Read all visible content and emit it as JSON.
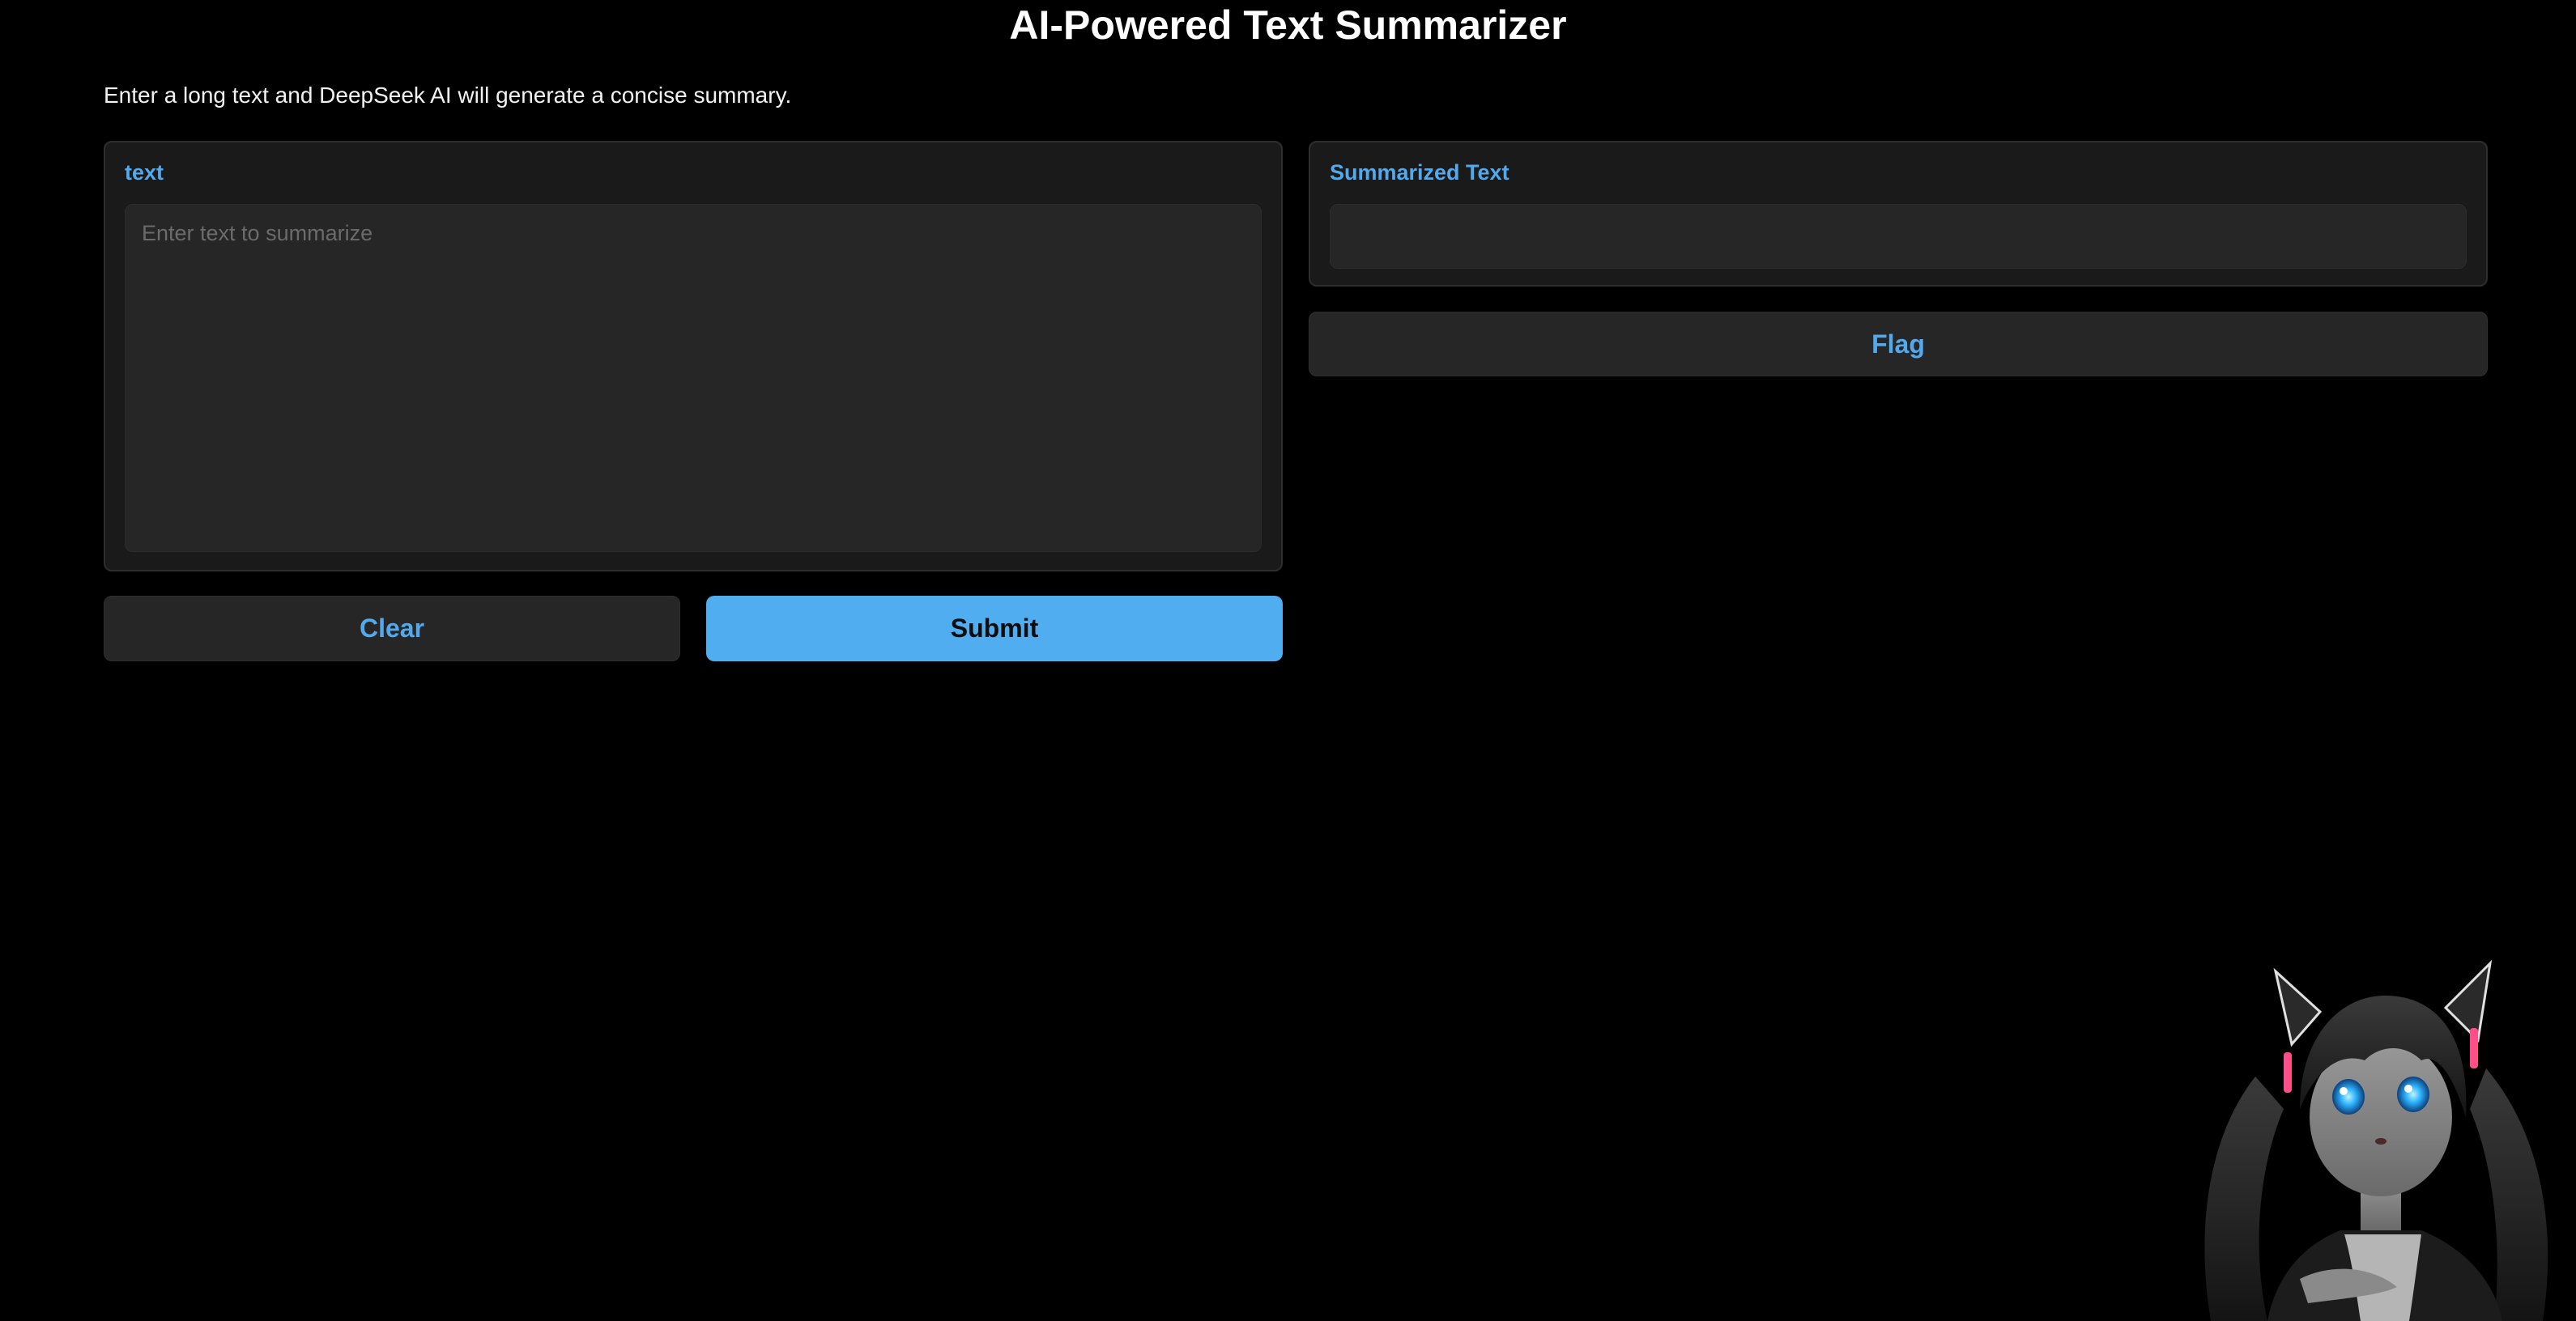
{
  "header": {
    "title": "AI-Powered Text Summarizer",
    "description": "Enter a long text and DeepSeek AI will generate a concise summary."
  },
  "input": {
    "label": "text",
    "placeholder": "Enter text to summarize",
    "value": ""
  },
  "output": {
    "label": "Summarized Text",
    "value": ""
  },
  "buttons": {
    "flag": "Flag",
    "clear": "Clear",
    "submit": "Submit"
  },
  "colors": {
    "accent": "#53a9ec",
    "primary_button": "#50adf0",
    "background": "#000000",
    "panel": "#1a1a1a",
    "field": "#262626"
  },
  "decor": {
    "mascot": "anime-cat-girl-mascot"
  }
}
